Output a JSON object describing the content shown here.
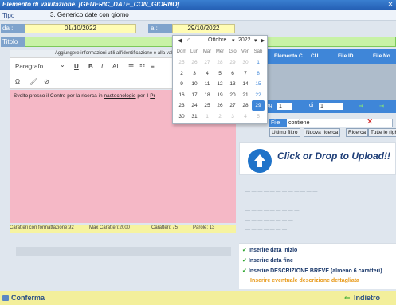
{
  "window": {
    "title": "Elemento di valutazione. [GENERIC_DATE_CON_GIORNO]"
  },
  "tipo": {
    "label": "Tipo",
    "value": "3. Generico date con giorno"
  },
  "dates": {
    "da_label": "da :",
    "da_value": "01/10/2022",
    "a_label": "a :",
    "a_value": "29/10/2022"
  },
  "titolo": {
    "label": "Titolo",
    "value": ""
  },
  "editor": {
    "strip": "Aggiungere informazioni utili all'identificazione e alla valutazione",
    "toolbar": {
      "paragraph": "Paragrafo",
      "chevron": "⌄",
      "underline": "U",
      "bold": "B",
      "italic": "I",
      "font_size": "AI",
      "bullets": "☰",
      "numbered": "☷",
      "align": "≡",
      "omega": "Ω",
      "paint": "🖌",
      "link": "⊘"
    },
    "content_before": "Svolto presso il Centro per la ricerca in ",
    "content_link": "nastecnologie",
    "content_mid": " per il ",
    "content_link2": "Pr",
    "status": {
      "formatted": "Caratteri con formattazione:92",
      "max": "Max Caratteri:2000",
      "chars": "Caratteri: 75",
      "words": "Parole: 13"
    }
  },
  "calendar": {
    "month": "Ottobre",
    "year": "2022",
    "dow": [
      "Dom",
      "Lun",
      "Mar",
      "Mer",
      "Gio",
      "Ven",
      "Sab"
    ],
    "weeks": [
      [
        "25",
        "26",
        "27",
        "28",
        "29",
        "30",
        "1"
      ],
      [
        "2",
        "3",
        "4",
        "5",
        "6",
        "7",
        "8"
      ],
      [
        "9",
        "10",
        "11",
        "12",
        "13",
        "14",
        "15"
      ],
      [
        "16",
        "17",
        "18",
        "19",
        "20",
        "21",
        "22"
      ],
      [
        "23",
        "24",
        "25",
        "26",
        "27",
        "28",
        "29"
      ],
      [
        "30",
        "31",
        "1",
        "2",
        "3",
        "4",
        "5"
      ]
    ],
    "selected": "29"
  },
  "grid": {
    "columns": [
      "Elemento C",
      "CU",
      "File ID",
      "File No"
    ],
    "pager": {
      "label": "pag",
      "page": "1",
      "of": "di",
      "total": "1"
    }
  },
  "filter": {
    "label": "File",
    "value": "contiene",
    "buttons": [
      "Ultimo filtro",
      "Nuova ricerca",
      "Ricerca",
      "Tutte le righe"
    ]
  },
  "upload": {
    "text": "Click or Drop to Upload!!"
  },
  "checks": [
    {
      "text": "Inserire data inizio",
      "ok": true
    },
    {
      "text": "Inserire data fine",
      "ok": true
    },
    {
      "text": "Inserire DESCRIZIONE BREVE (almeno 6 caratteri)",
      "ok": true
    },
    {
      "text": "Inserire eventuale descrizione dettagliata",
      "ok": false
    }
  ],
  "footer": {
    "confirm": "Conferma",
    "back": "Indietro"
  },
  "colors": {
    "accent": "#3f86d8",
    "titlebar": "#2560b5",
    "editor_bg": "#f5b8c6",
    "titolo_bg": "#c8f2a6",
    "date_bg": "#fffcb4"
  }
}
